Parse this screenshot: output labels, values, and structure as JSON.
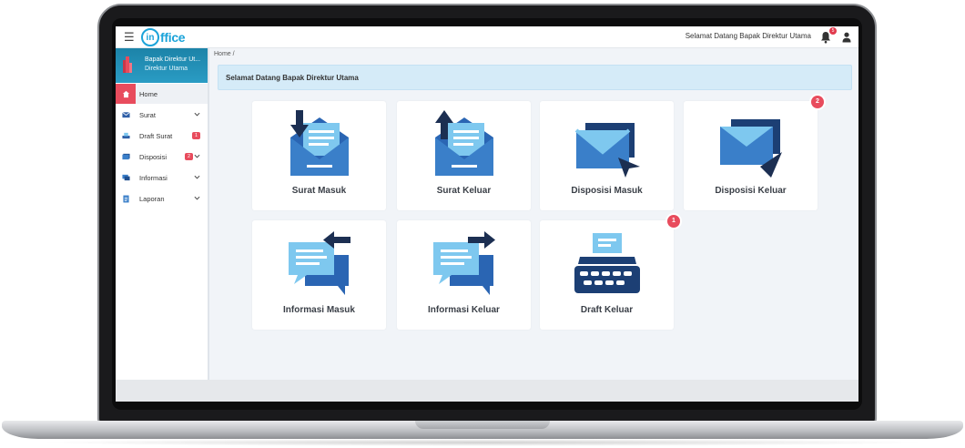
{
  "app": {
    "logo_in": "in",
    "logo_rest": "ffice",
    "welcome_top": "Selamat Datang Bapak Direktur Utama",
    "notification_count": "5"
  },
  "sidebar": {
    "profile_name": "Bapak Direktur Ut...",
    "profile_role": "Direktur Utama",
    "items": [
      {
        "label": "Home",
        "icon": "home-icon",
        "active": true
      },
      {
        "label": "Surat",
        "icon": "mail-icon",
        "expandable": true
      },
      {
        "label": "Draft Surat",
        "icon": "draft-icon",
        "badge": "1"
      },
      {
        "label": "Disposisi",
        "icon": "disposition-icon",
        "badge": "2",
        "expandable": true
      },
      {
        "label": "Informasi",
        "icon": "info-icon",
        "expandable": true
      },
      {
        "label": "Laporan",
        "icon": "report-icon",
        "expandable": true
      }
    ]
  },
  "breadcrumb": "Home /",
  "welcome_panel": "Selamat Datang Bapak Direktur Utama",
  "tiles": [
    {
      "label": "Surat Masuk",
      "icon": "incoming-mail-icon"
    },
    {
      "label": "Surat Keluar",
      "icon": "outgoing-mail-icon"
    },
    {
      "label": "Disposisi Masuk",
      "icon": "incoming-disposition-icon"
    },
    {
      "label": "Disposisi Keluar",
      "icon": "outgoing-disposition-icon",
      "badge": "2"
    },
    {
      "label": "Informasi Masuk",
      "icon": "incoming-info-icon"
    },
    {
      "label": "Informasi Keluar",
      "icon": "outgoing-info-icon"
    },
    {
      "label": "Draft Keluar",
      "icon": "typewriter-icon",
      "badge": "1"
    }
  ],
  "colors": {
    "accent": "#1aa3d9",
    "icon_dark": "#1f4f8f",
    "icon_mid": "#3a7fc9",
    "icon_light": "#7ec8ef",
    "badge": "#e84c5d"
  }
}
